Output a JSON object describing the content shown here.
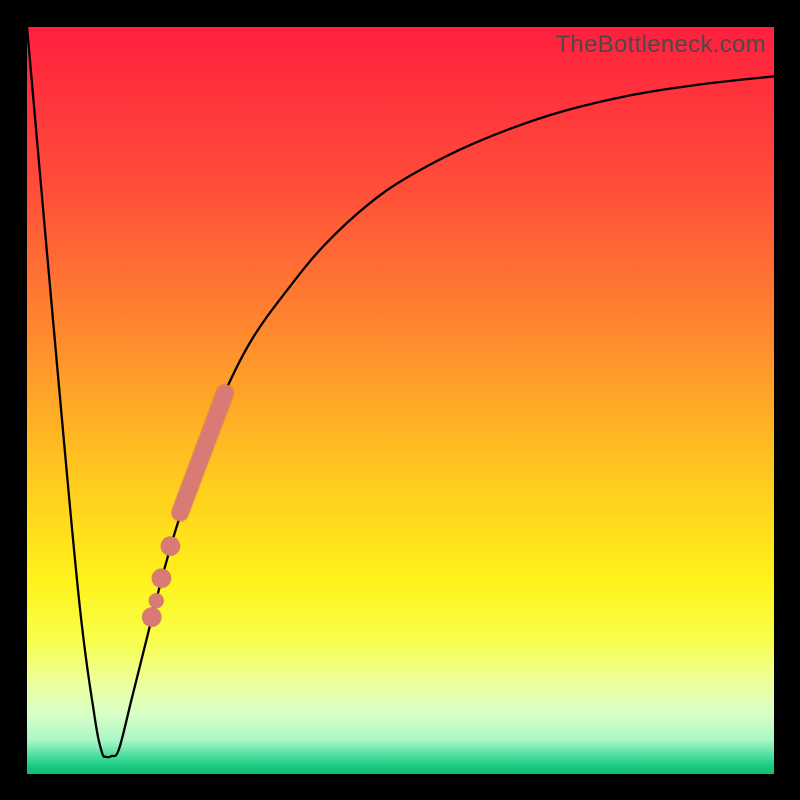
{
  "watermark": "TheBottleneck.com",
  "colors": {
    "frame": "#000000",
    "curve": "#000000",
    "marker_fill": "#d97b74",
    "marker_stroke": "#a85650",
    "gradient_stops": [
      {
        "offset": 0.0,
        "color": "#ff1f3e"
      },
      {
        "offset": 0.22,
        "color": "#ff4f39"
      },
      {
        "offset": 0.42,
        "color": "#ff8c2e"
      },
      {
        "offset": 0.6,
        "color": "#ffc81f"
      },
      {
        "offset": 0.74,
        "color": "#fff21a"
      },
      {
        "offset": 0.82,
        "color": "#f8ff4a"
      },
      {
        "offset": 0.88,
        "color": "#ecffa0"
      },
      {
        "offset": 0.92,
        "color": "#d8ffc6"
      },
      {
        "offset": 0.955,
        "color": "#a9f7c6"
      },
      {
        "offset": 0.975,
        "color": "#4de0a0"
      },
      {
        "offset": 0.99,
        "color": "#17c97e"
      },
      {
        "offset": 1.0,
        "color": "#0fbf72"
      }
    ]
  },
  "chart_data": {
    "type": "line",
    "title": "",
    "xlabel": "",
    "ylabel": "",
    "xlim": [
      0,
      100
    ],
    "ylim": [
      0,
      100
    ],
    "series": [
      {
        "name": "bottleneck-curve",
        "x": [
          0,
          4,
          7,
          9,
          10,
          10.6,
          11.3,
          12.3,
          14,
          16,
          18,
          20,
          23,
          26,
          30,
          35,
          40,
          46,
          52,
          60,
          70,
          80,
          90,
          100
        ],
        "values": [
          100,
          55,
          23,
          8,
          3.0,
          2.3,
          2.4,
          3.3,
          10,
          18,
          26,
          33,
          42,
          50,
          58,
          65,
          71,
          76.5,
          80.5,
          84.5,
          88.2,
          90.7,
          92.3,
          93.4
        ]
      }
    ],
    "markers": [
      {
        "name": "highlight-segment",
        "shape": "round-thick",
        "x1": 20.5,
        "y1": 35.0,
        "x2": 26.5,
        "y2": 51.0
      },
      {
        "name": "dot",
        "x": 19.2,
        "y": 30.5,
        "r": 1.3
      },
      {
        "name": "dot",
        "x": 18.0,
        "y": 26.2,
        "r": 1.3
      },
      {
        "name": "dot",
        "x": 16.7,
        "y": 21.0,
        "r": 1.3
      },
      {
        "name": "dot",
        "x": 17.3,
        "y": 23.2,
        "r": 1.0
      }
    ]
  }
}
